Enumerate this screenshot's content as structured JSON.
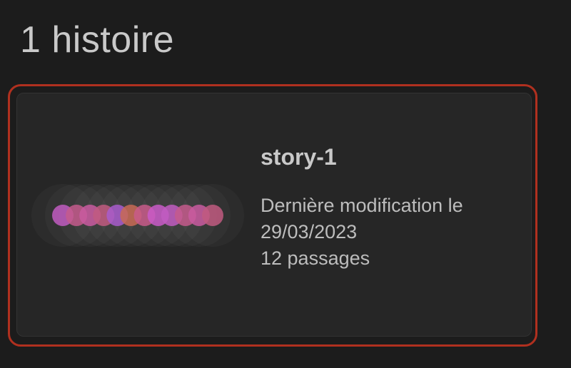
{
  "library": {
    "heading": "1 histoire"
  },
  "story": {
    "name": "story-1",
    "modified_label": "Dernière modification le",
    "modified_date": "29/03/2023",
    "passages": "12 passages",
    "passage_count": 12,
    "selected": true
  },
  "colors": {
    "background": "#1c1c1c",
    "card": "#262626",
    "selection": "#b0301f",
    "text_primary": "#c9c9c9",
    "text_secondary": "#bdbdbd",
    "passage_colors": [
      "#c15cc1",
      "#c45a8c",
      "#c95aa0",
      "#c15a80",
      "#a85ccc",
      "#c86a55",
      "#c85a8a",
      "#c95ac8"
    ]
  }
}
